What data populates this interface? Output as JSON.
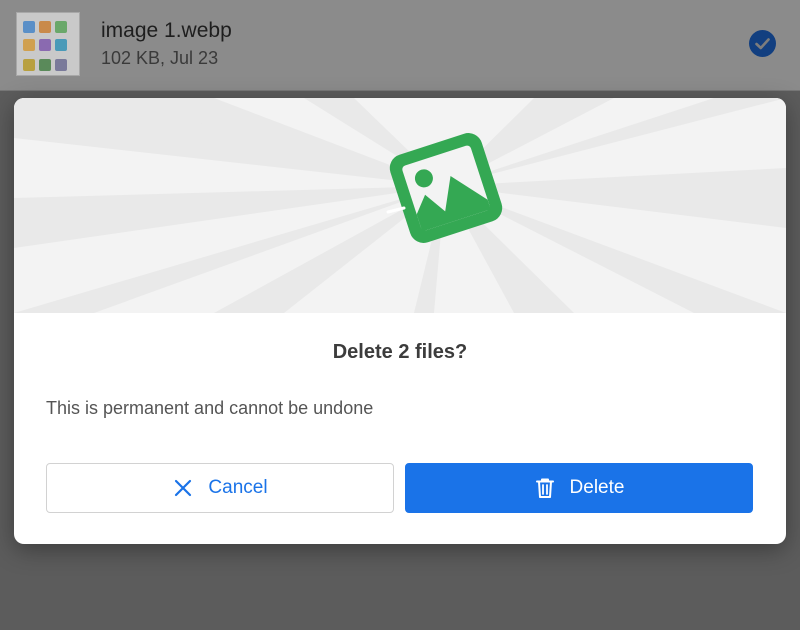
{
  "background_list": {
    "file": {
      "name": "image 1.webp",
      "meta": "102 KB, Jul 23",
      "selected": true,
      "thumbnail_icon": "image-thumbnail",
      "check_icon": "check-circle-icon"
    }
  },
  "dialog": {
    "illustration_icon": "image-icon",
    "title": "Delete 2 files?",
    "message": "This is permanent and cannot be undone",
    "cancel_button": {
      "label": "Cancel",
      "icon": "close-icon"
    },
    "delete_button": {
      "label": "Delete",
      "icon": "trash-icon"
    }
  },
  "colors": {
    "accent": "#1a73e8",
    "illustration_green": "#34a853",
    "scrim": "#5f5f5f"
  }
}
